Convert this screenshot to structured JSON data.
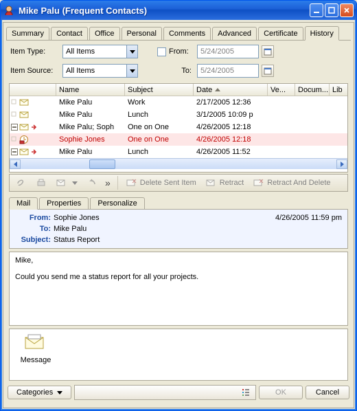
{
  "window": {
    "title": "Mike Palu (Frequent Contacts)"
  },
  "top_tabs": [
    "Summary",
    "Contact",
    "Office",
    "Personal",
    "Comments",
    "Advanced",
    "Certificate",
    "History"
  ],
  "top_tabs_active": 7,
  "filter": {
    "item_type_label": "Item Type:",
    "item_type_value": "All Items",
    "item_source_label": "Item Source:",
    "item_source_value": "All Items",
    "from_label": "From:",
    "from_value": "5/24/2005",
    "to_label": "To:",
    "to_value": "5/24/2005"
  },
  "columns": [
    "Name",
    "Subject",
    "Date",
    "Ve...",
    "Docum...",
    "Lib"
  ],
  "rows": [
    {
      "name": "Mike Palu",
      "subject": "Work",
      "date": "2/17/2005 12:36",
      "sel": false,
      "boxed": false,
      "fw": false
    },
    {
      "name": "Mike Palu",
      "subject": "Lunch",
      "date": "3/1/2005 10:09 p",
      "sel": false,
      "boxed": false,
      "fw": false
    },
    {
      "name": "Mike Palu;  Soph",
      "subject": "One on One",
      "date": "4/26/2005 12:18",
      "sel": false,
      "boxed": true,
      "fw": true
    },
    {
      "name": "Sophie Jones",
      "subject": "One on One",
      "date": "4/26/2005 12:18",
      "sel": true,
      "boxed": false,
      "fw": false
    },
    {
      "name": "Mike Palu",
      "subject": "Lunch",
      "date": "4/26/2005 11:52",
      "sel": false,
      "boxed": true,
      "fw": true
    }
  ],
  "toolbar": {
    "delete_sent": "Delete Sent Item",
    "retract": "Retract",
    "retract_delete": "Retract And Delete"
  },
  "low_tabs": [
    "Mail",
    "Properties",
    "Personalize"
  ],
  "low_tabs_active": 0,
  "mail": {
    "from_lab": "From:",
    "from": "Sophie Jones",
    "to_lab": "To:",
    "to": "Mike Palu",
    "subj_lab": "Subject:",
    "subj": "Status Report",
    "timestamp": "4/26/2005 11:59 pm",
    "body_greet": "Mike,",
    "body_text": "Could you send me a status report for all your projects."
  },
  "attachment": {
    "label": "Message"
  },
  "buttons": {
    "categories": "Categories",
    "ok": "OK",
    "cancel": "Cancel"
  }
}
